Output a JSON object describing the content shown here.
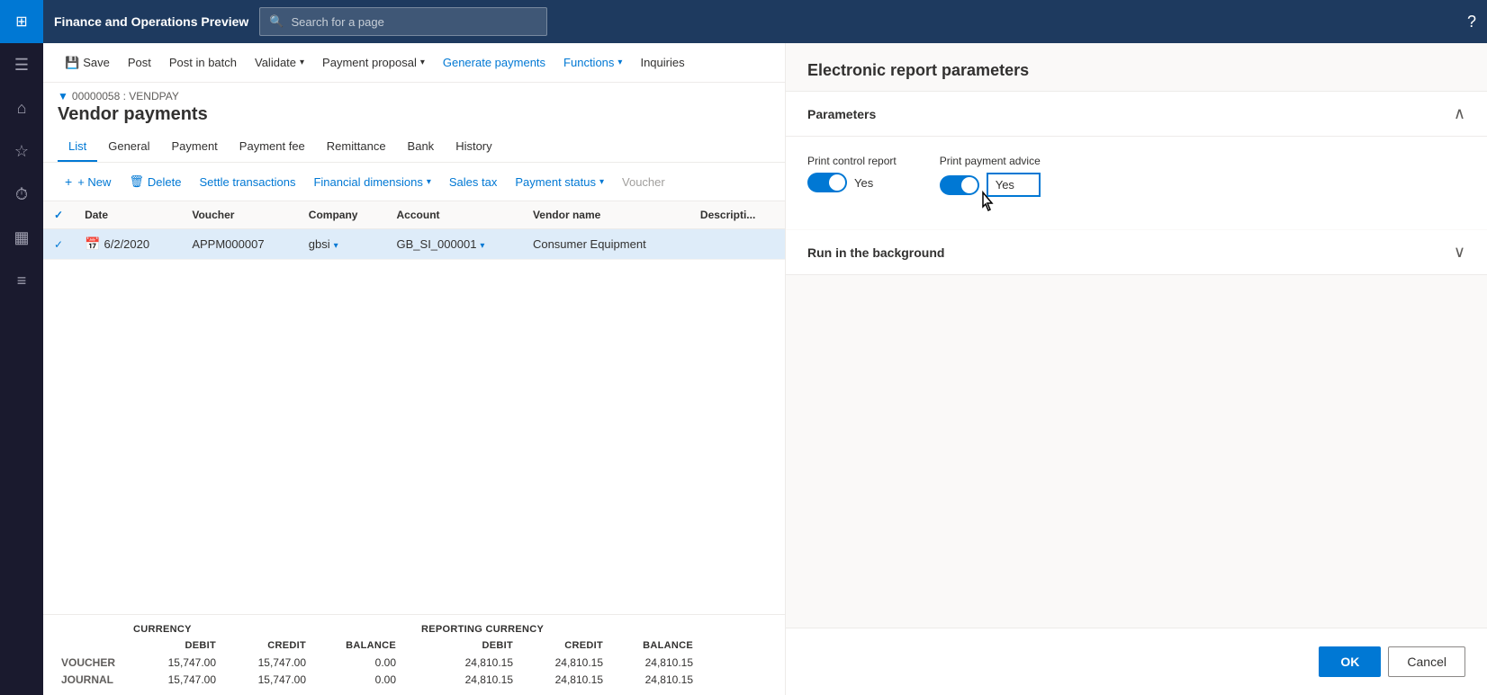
{
  "app": {
    "title": "Finance and Operations Preview",
    "search_placeholder": "Search for a page"
  },
  "sidebar": {
    "icons": [
      "grid",
      "home",
      "star",
      "history",
      "table",
      "list"
    ]
  },
  "command_bar": {
    "save_label": "Save",
    "post_label": "Post",
    "post_batch_label": "Post in batch",
    "validate_label": "Validate",
    "payment_proposal_label": "Payment proposal",
    "generate_payments_label": "Generate payments",
    "functions_label": "Functions",
    "inquiries_label": "Inquiries"
  },
  "page": {
    "breadcrumb": "00000058 : VENDPAY",
    "title": "Vendor payments"
  },
  "tabs": [
    {
      "label": "List",
      "active": true
    },
    {
      "label": "General",
      "active": false
    },
    {
      "label": "Payment",
      "active": false
    },
    {
      "label": "Payment fee",
      "active": false
    },
    {
      "label": "Remittance",
      "active": false
    },
    {
      "label": "Bank",
      "active": false
    },
    {
      "label": "History",
      "active": false
    }
  ],
  "toolbar": {
    "new_label": "+ New",
    "delete_label": "Delete",
    "settle_label": "Settle transactions",
    "financial_dim_label": "Financial dimensions",
    "sales_tax_label": "Sales tax",
    "payment_status_label": "Payment status",
    "voucher_label": "Voucher"
  },
  "table": {
    "columns": [
      "",
      "Date",
      "Voucher",
      "Company",
      "Account",
      "Vendor name",
      "Descripti..."
    ],
    "rows": [
      {
        "selected": true,
        "date": "6/2/2020",
        "voucher": "APPM000007",
        "company": "gbsi",
        "account": "GB_SI_000001",
        "vendor_name": "Consumer Equipment",
        "description": ""
      }
    ]
  },
  "footer": {
    "currency_label": "CURRENCY",
    "reporting_currency_label": "REPORTING CURRENCY",
    "debit_label": "DEBIT",
    "credit_label": "CREDIT",
    "balance_label": "BALANCE",
    "rows": [
      {
        "label": "VOUCHER",
        "debit": "15,747.00",
        "credit": "15,747.00",
        "balance": "0.00",
        "rep_debit": "24,810.15",
        "rep_credit": "24,810.15",
        "rep_balance": "24,810.15"
      },
      {
        "label": "JOURNAL",
        "debit": "15,747.00",
        "credit": "15,747.00",
        "balance": "0.00",
        "rep_debit": "24,810.15",
        "rep_credit": "24,810.15",
        "rep_balance": "24,810.15"
      }
    ]
  },
  "panel": {
    "title": "Electronic report parameters",
    "parameters_label": "Parameters",
    "print_control_report_label": "Print control report",
    "print_control_report_value": "Yes",
    "print_control_toggle_on": true,
    "print_payment_advice_label": "Print payment advice",
    "print_payment_advice_value": "Yes",
    "print_payment_toggle_on": true,
    "run_in_background_label": "Run in the background",
    "ok_label": "OK",
    "cancel_label": "Cancel"
  }
}
